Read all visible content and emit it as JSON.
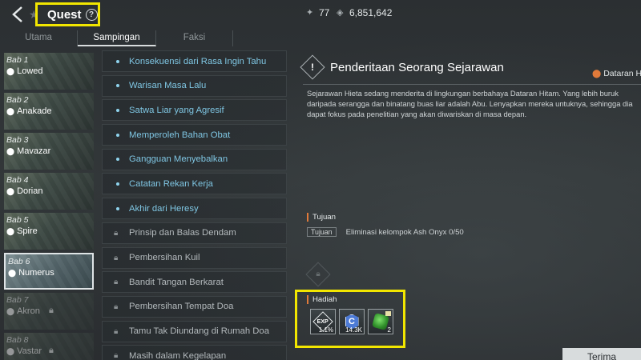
{
  "header": {
    "title": "Quest",
    "help_symbol": "?",
    "currency_a": "77",
    "currency_b": "6,851,642"
  },
  "tabs": [
    {
      "label": "Utama",
      "active": false
    },
    {
      "label": "Sampingan",
      "active": true
    },
    {
      "label": "Faksi",
      "active": false
    }
  ],
  "chapters": [
    {
      "bab": "Bab 1",
      "name": "Lowed",
      "state": "normal"
    },
    {
      "bab": "Bab 2",
      "name": "Anakade",
      "state": "normal"
    },
    {
      "bab": "Bab 3",
      "name": "Mavazar",
      "state": "normal"
    },
    {
      "bab": "Bab 4",
      "name": "Dorian",
      "state": "normal"
    },
    {
      "bab": "Bab 5",
      "name": "Spire",
      "state": "normal"
    },
    {
      "bab": "Bab 6",
      "name": "Numerus",
      "state": "active"
    },
    {
      "bab": "Bab 7",
      "name": "Akron",
      "state": "locked"
    },
    {
      "bab": "Bab 8",
      "name": "Vastar",
      "state": "locked"
    }
  ],
  "quests": [
    {
      "label": "Konsekuensi dari Rasa Ingin Tahu",
      "state": "avail"
    },
    {
      "label": "Warisan Masa Lalu",
      "state": "avail"
    },
    {
      "label": "Satwa Liar yang Agresif",
      "state": "avail"
    },
    {
      "label": "Memperoleh Bahan Obat",
      "state": "avail"
    },
    {
      "label": "Gangguan Menyebalkan",
      "state": "avail"
    },
    {
      "label": "Catatan Rekan Kerja",
      "state": "avail"
    },
    {
      "label": "Akhir dari Heresy",
      "state": "avail"
    },
    {
      "label": "Prinsip dan Balas Dendam",
      "state": "locked"
    },
    {
      "label": "Pembersihan Kuil",
      "state": "locked"
    },
    {
      "label": "Bandit Tangan Berkarat",
      "state": "locked"
    },
    {
      "label": "Pembersihan Tempat Doa",
      "state": "locked"
    },
    {
      "label": "Tamu Tak Diundang di Rumah Doa",
      "state": "locked"
    },
    {
      "label": "Masih dalam Kegelapan",
      "state": "locked"
    }
  ],
  "detail": {
    "icon_symbol": "!",
    "title": "Penderitaan Seorang Sejarawan",
    "location": "Dataran Hi",
    "description": "Sejarawan Hieta sedang menderita di lingkungan berbahaya Dataran Hitam. Yang lebih buruk daripada serangga dan binatang buas liar adalah Abu. Lenyapkan mereka untuknya, sehingga dia dapat fokus pada penelitian yang akan diwariskan di masa depan.",
    "objective_heading": "Tujuan",
    "objective_tag": "Tujuan",
    "objective_text": "Eliminasi kelompok Ash Onyx 0/50",
    "reward_heading": "Hadiah",
    "rewards": [
      {
        "icon": "exp-icon",
        "icon_text": "EXP",
        "qty": "1.1%"
      },
      {
        "icon": "credit-icon",
        "icon_text": "C",
        "qty": "14.3K"
      },
      {
        "icon": "green-gem-icon",
        "icon_text": "",
        "qty": "2"
      }
    ],
    "accept_label": "Terima"
  },
  "colors": {
    "highlight": "#f2e600",
    "quest_available": "#7fc6e3",
    "location_pin": "#e07a3a"
  }
}
